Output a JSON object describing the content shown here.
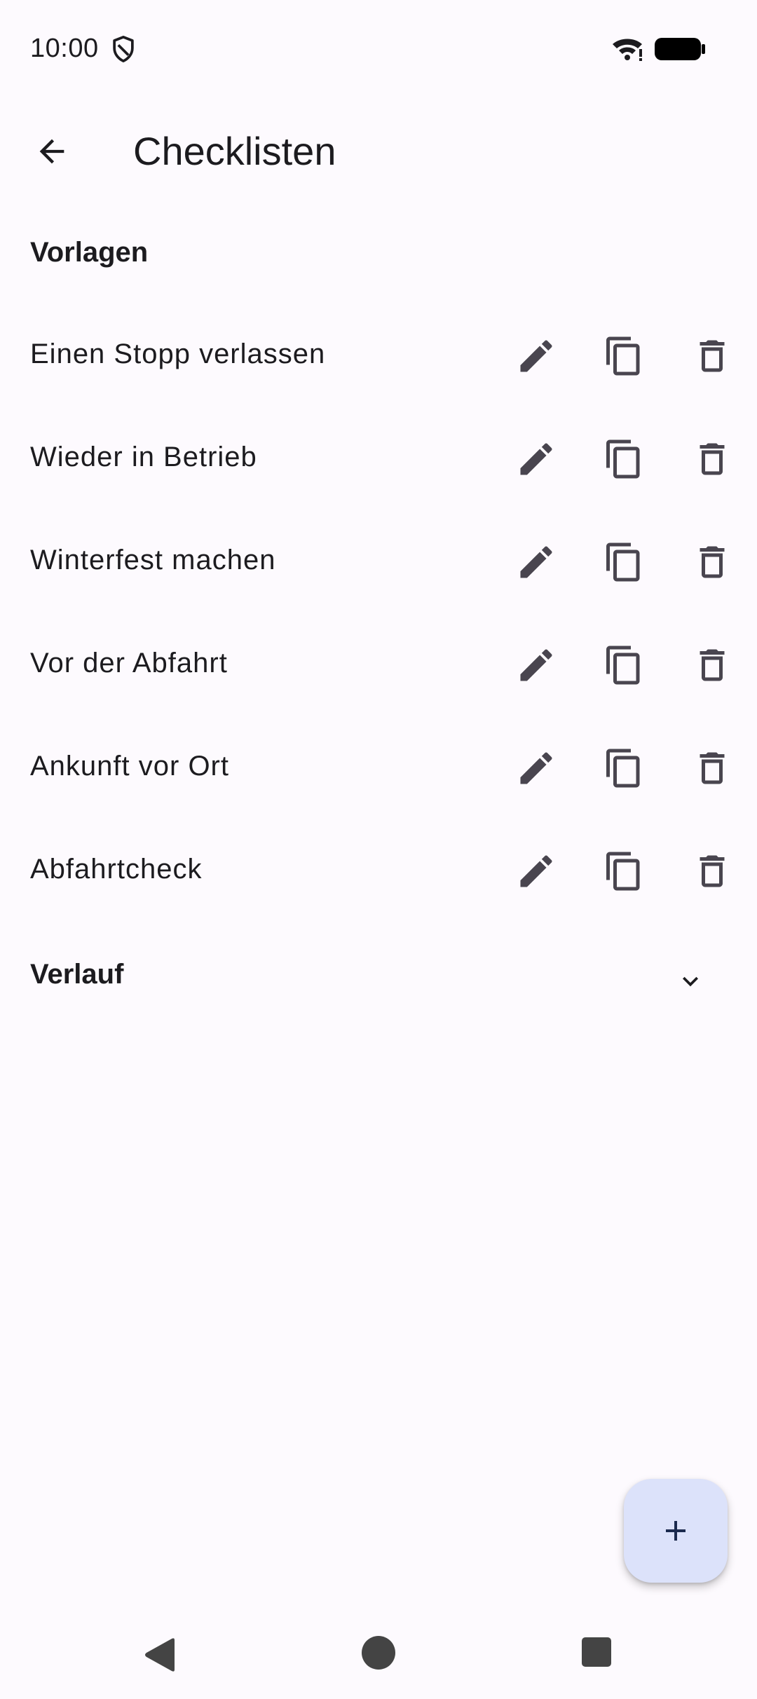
{
  "status_bar": {
    "time": "10:00"
  },
  "app_bar": {
    "title": "Checklisten"
  },
  "sections": {
    "templates_header": "Vorlagen",
    "history_header": "Verlauf"
  },
  "templates": [
    {
      "label": "Einen Stopp verlassen"
    },
    {
      "label": "Wieder in Betrieb"
    },
    {
      "label": "Winterfest machen"
    },
    {
      "label": "Vor der Abfahrt"
    },
    {
      "label": "Ankunft vor Ort"
    },
    {
      "label": "Abfahrtcheck"
    }
  ],
  "icons": {
    "back": "arrow-back-icon",
    "edit": "pencil-icon",
    "copy": "copy-icon",
    "delete": "trash-icon",
    "expand": "chevron-down-icon",
    "add": "plus-icon"
  },
  "colors": {
    "background": "#FDFAFE",
    "text": "#1C1B1F",
    "icon": "#49454F",
    "fab": "#DCE2FA",
    "fab_icon": "#1B2A4E"
  }
}
